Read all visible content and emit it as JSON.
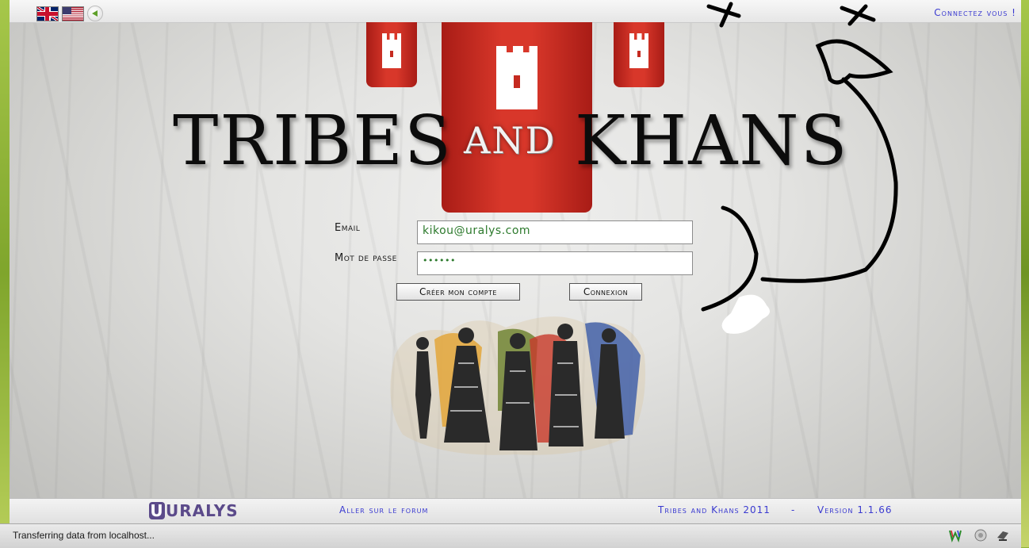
{
  "header": {
    "flags": [
      "uk-flag-icon",
      "us-flag-icon"
    ],
    "sound_icon": "speaker-icon",
    "connect_prompt": "Connectez vous !"
  },
  "logo": {
    "word1": "TRIBES",
    "word2": "AND",
    "word3": "KHANS"
  },
  "form": {
    "email_label": "Email",
    "email_value": "kikou@uralys.com",
    "password_label": "Mot de passe",
    "password_value": "••••••",
    "create_account_label": "Créer mon compte",
    "login_label": "Connexion"
  },
  "footer": {
    "brand": "URALYS",
    "forum_link": "Aller sur le forum",
    "game_name": "Tribes and Khans 2011",
    "separator": "-",
    "version": "Version 1.1.66"
  },
  "statusbar": {
    "text": "Transferring data from localhost...",
    "icons": [
      "extension-w-icon",
      "sync-icon",
      "script-icon"
    ]
  },
  "colors": {
    "banner_red": "#d8372a",
    "link_blue": "#3a3ad0",
    "input_text_green": "#2d7a2d",
    "frame_green": "#8fb23a"
  }
}
